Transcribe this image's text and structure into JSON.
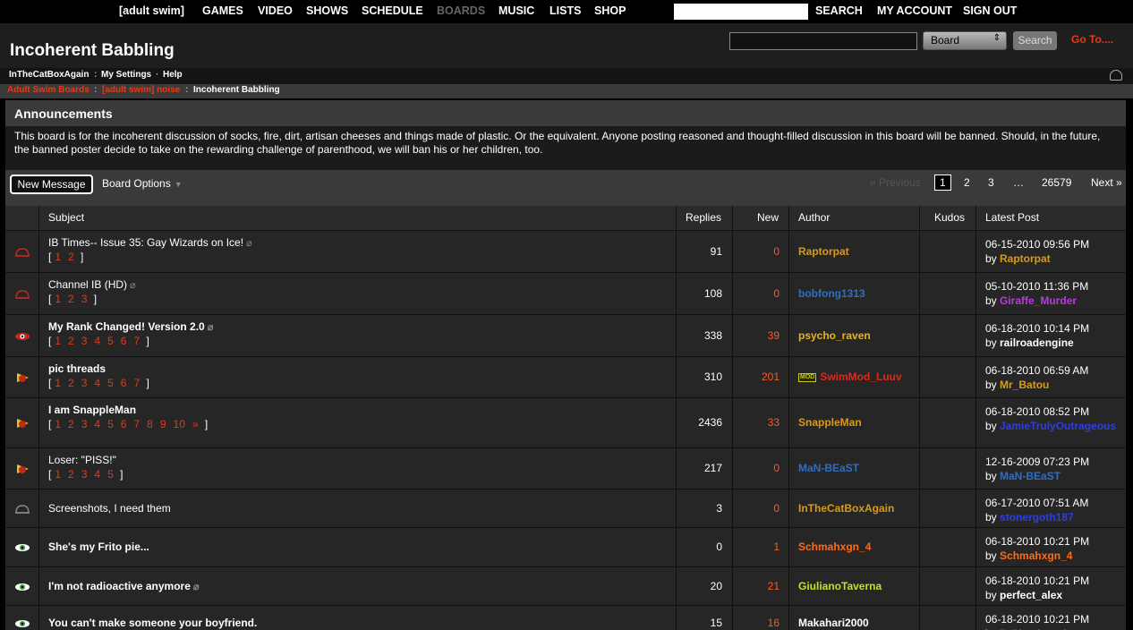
{
  "topnav": {
    "brand": "[adult swim]",
    "items": [
      "GAMES",
      "VIDEO",
      "SHOWS",
      "SCHEDULE",
      "BOARDS",
      "MUSIC",
      "LISTS",
      "SHOP"
    ],
    "search": "SEARCH",
    "account": "MY ACCOUNT",
    "signout": "SIGN OUT"
  },
  "header": {
    "title": "Incoherent Babbling",
    "board_select": "Board",
    "search_button": "Search",
    "goto": "Go To...."
  },
  "userbar": {
    "user": "InTheCatBoxAgain",
    "settings": "My Settings",
    "help": "Help"
  },
  "breadcrumb": [
    "Adult Swim Boards",
    "[adult swim] noise",
    "Incoherent Babbling"
  ],
  "announcements": {
    "title": "Announcements",
    "text": "This board is for the incoherent discussion of socks, fire, dirt, artisan cheeses and things made of plastic. Or the equivalent. Anyone posting reasoned and thought-filled discussion in this board will be banned. Should, in the future, the banned poster decide to take on the rewarding challenge of parenthood, we will ban his or her children, too."
  },
  "toolbar": {
    "new_message": "New Message",
    "board_options": "Board Options",
    "prev": "« Previous",
    "pages": [
      "1",
      "2",
      "3",
      "…",
      "26579"
    ],
    "next": "Next »"
  },
  "columns": [
    "Subject",
    "Replies",
    "New",
    "Author",
    "Kudos",
    "Latest Post"
  ],
  "colors": {
    "accent": "#e03c1a",
    "orange": "#ff5a1e"
  },
  "rows": [
    {
      "subject": "IB Times-- Issue 35: Gay Wizards on Ice!",
      "bold": false,
      "attach": true,
      "pages": [
        "1",
        "2"
      ],
      "replies": "91",
      "new": "0",
      "author": "Raptorpat",
      "author_color": "#d99a1a",
      "mod": false,
      "lp_date": "06-15-2010 09:56 PM",
      "lp_by": "Raptorpat",
      "lp_color": "#d99a1a",
      "icon": "read"
    },
    {
      "subject": "Channel IB (HD)",
      "bold": false,
      "attach": true,
      "pages": [
        "1",
        "2",
        "3"
      ],
      "replies": "108",
      "new": "0",
      "author": "bobfong1313",
      "author_color": "#2f6fc0",
      "mod": false,
      "lp_date": "05-10-2010 11:36 PM",
      "lp_by": "Giraffe_Murder",
      "lp_color": "#b23fd6",
      "icon": "read"
    },
    {
      "subject": "My Rank Changed! Version 2.0",
      "bold": true,
      "attach": true,
      "pages": [
        "1",
        "2",
        "3",
        "4",
        "5",
        "6",
        "7"
      ],
      "replies": "338",
      "new": "39",
      "author": "psycho_raven",
      "author_color": "#e8b320",
      "mod": false,
      "lp_date": "06-18-2010 10:14 PM",
      "lp_by": "railroadengine",
      "lp_color": "#ffffff",
      "icon": "hot"
    },
    {
      "subject": "pic threads",
      "bold": true,
      "attach": false,
      "pages": [
        "1",
        "2",
        "3",
        "4",
        "5",
        "6",
        "7"
      ],
      "replies": "310",
      "new": "201",
      "author": "SwimMod_Luuv",
      "author_color": "#e0281a",
      "mod": true,
      "lp_date": "06-18-2010 06:59 AM",
      "lp_by": "Mr_Batou",
      "lp_color": "#d99a1a",
      "icon": "sticky"
    },
    {
      "subject": "I am SnappleMan",
      "bold": true,
      "attach": false,
      "pages": [
        "1",
        "2",
        "3",
        "4",
        "5",
        "6",
        "7",
        "8",
        "9",
        "10",
        "»"
      ],
      "replies": "2436",
      "new": "33",
      "author": "SnappleMan",
      "author_color": "#d99a1a",
      "mod": false,
      "lp_date": "06-18-2010 08:52 PM",
      "lp_by": "JamieTrulyOutrageous",
      "lp_color": "#2e3fe0",
      "icon": "sticky"
    },
    {
      "subject": "Loser: \"PISS!\"",
      "bold": false,
      "attach": false,
      "pages": [
        "1",
        "2",
        "3",
        "4",
        "5"
      ],
      "replies": "217",
      "new": "0",
      "author": "MaN-BEaST",
      "author_color": "#2f6fc0",
      "mod": false,
      "lp_date": "12-16-2009 07:23 PM",
      "lp_by": "MaN-BEaST",
      "lp_color": "#2f6fc0",
      "icon": "sticky"
    },
    {
      "subject": "Screenshots, I need them",
      "bold": false,
      "attach": false,
      "pages": [],
      "replies": "3",
      "new": "0",
      "author": "InTheCatBoxAgain",
      "author_color": "#d99a1a",
      "mod": false,
      "lp_date": "06-17-2010 07:51 AM",
      "lp_by": "stonergoth187",
      "lp_color": "#2e3fe0",
      "icon": "grey"
    },
    {
      "subject": "She's my Frito pie...",
      "bold": true,
      "attach": false,
      "pages": [],
      "replies": "0",
      "new": "1",
      "author": "Schmahxgn_4",
      "author_color": "#ff6a1a",
      "mod": false,
      "lp_date": "06-18-2010 10:21 PM",
      "lp_by": "Schmahxgn_4",
      "lp_color": "#ff6a1a",
      "icon": "new"
    },
    {
      "subject": "I'm not radioactive anymore",
      "bold": true,
      "attach": true,
      "pages": [],
      "replies": "20",
      "new": "21",
      "author": "GiulianoTaverna",
      "author_color": "#c8e020",
      "mod": false,
      "lp_date": "06-18-2010 10:21 PM",
      "lp_by": "perfect_alex",
      "lp_color": "#ffffff",
      "icon": "new"
    },
    {
      "subject": "You can't make someone your boyfriend.",
      "bold": true,
      "attach": false,
      "pages": [],
      "replies": "15",
      "new": "16",
      "author": "Makahari2000",
      "author_color": "#ffffff",
      "mod": false,
      "lp_date": "06-18-2010 10:21 PM",
      "lp_by": "DrPheelgood",
      "lp_color": "#e0281a",
      "icon": "new"
    }
  ]
}
